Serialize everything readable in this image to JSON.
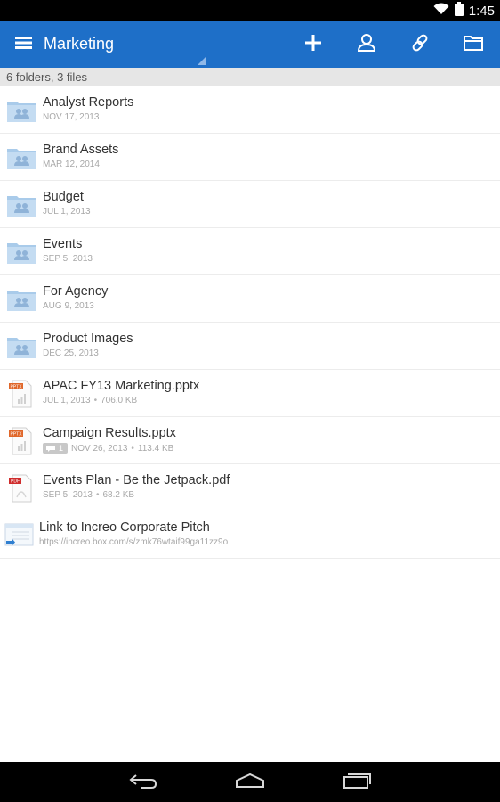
{
  "status": {
    "time": "1:45"
  },
  "app_bar": {
    "title": "Marketing",
    "icons": [
      "menu-icon",
      "add-icon",
      "collaborator-icon",
      "link-icon",
      "folder-icon"
    ],
    "color": "#1e6fc8"
  },
  "summary": "6 folders, 3 files",
  "items": [
    {
      "type": "folder",
      "title": "Analyst Reports",
      "date": "NOV 17, 2013"
    },
    {
      "type": "folder",
      "title": "Brand Assets",
      "date": "MAR 12, 2014"
    },
    {
      "type": "folder",
      "title": "Budget",
      "date": "JUL 1, 2013"
    },
    {
      "type": "folder",
      "title": "Events",
      "date": "SEP 5, 2013"
    },
    {
      "type": "folder",
      "title": "For Agency",
      "date": "AUG 9, 2013"
    },
    {
      "type": "folder",
      "title": "Product Images",
      "date": "DEC 25, 2013"
    },
    {
      "type": "pptx",
      "title": "APAC FY13 Marketing.pptx",
      "date": "JUL 1, 2013",
      "size": "706.0 KB",
      "icon_label": "PPTX"
    },
    {
      "type": "pptx",
      "title": "Campaign Results.pptx",
      "date": "NOV 26, 2013",
      "size": "113.4 KB",
      "icon_label": "PPTX",
      "comment_count": "1"
    },
    {
      "type": "pdf",
      "title": "Events Plan - Be the Jetpack.pdf",
      "date": "SEP 5, 2013",
      "size": "68.2 KB",
      "icon_label": "PDF"
    },
    {
      "type": "weblink",
      "title": "Link to Increo Corporate Pitch",
      "url": "https://increo.box.com/s/zmk76wtaif99ga11zz9o"
    }
  ],
  "meta_separator": "•",
  "nav": {
    "icons": [
      "back-icon",
      "home-icon",
      "recent-apps-icon"
    ]
  }
}
